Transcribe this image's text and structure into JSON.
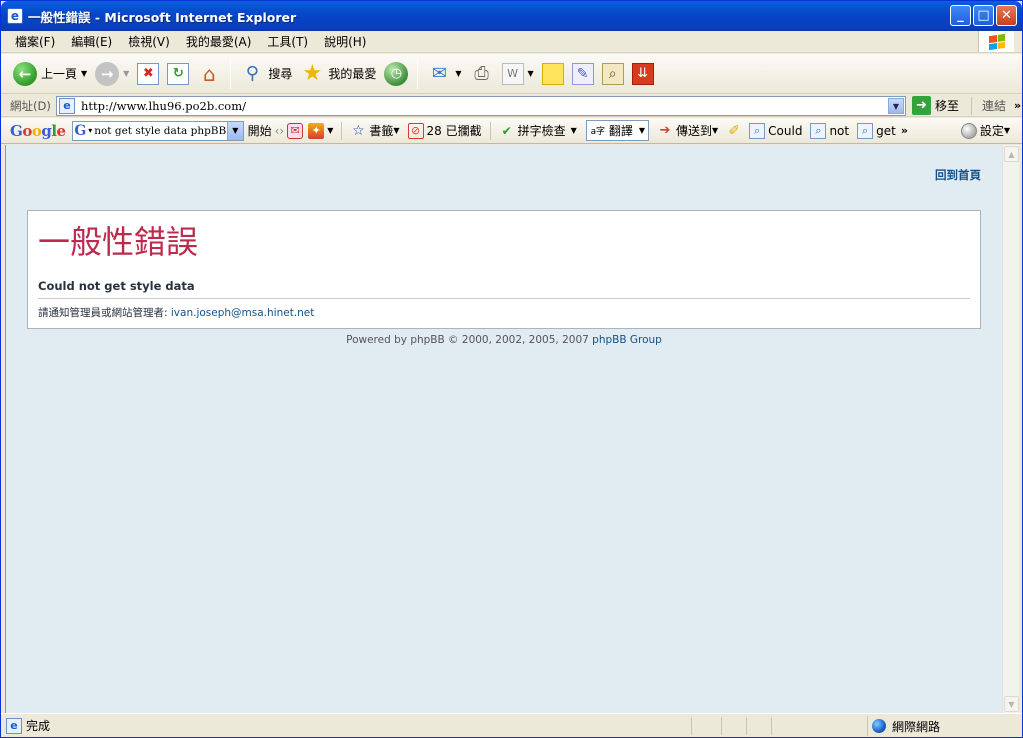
{
  "window": {
    "title": "一般性錯誤 - Microsoft Internet Explorer"
  },
  "menu": [
    "檔案(F)",
    "編輯(E)",
    "檢視(V)",
    "我的最愛(A)",
    "工具(T)",
    "說明(H)"
  ],
  "toolbar": {
    "back_label": "上一頁",
    "search_label": "搜尋",
    "favorites_label": "我的最愛"
  },
  "address": {
    "label": "網址(D)",
    "url": "http://www.lhu96.po2b.com/",
    "go_label": "移至",
    "links_label": "連結"
  },
  "google_toolbar": {
    "logo": "Google",
    "search_text": "not get style data  phpBB",
    "search_button": "開始",
    "bookmarks_label": "書籤",
    "blocked_label": "28 已攔截",
    "spellcheck_label": "拼字檢查",
    "translate_label": "翻譯",
    "sendto_label": "傳送到",
    "word1": "Could",
    "word2": "not",
    "word3": "get",
    "settings_label": "設定"
  },
  "page": {
    "home_link": "回到首頁",
    "error_title": "一般性錯誤",
    "error_message": "Could not get style data",
    "notice_prefix": "請通知管理員或網站管理者:",
    "notice_email": "ivan.joseph@msa.hinet.net",
    "footer_prefix": "Powered by phpBB © 2000, 2002, 2005, 2007",
    "footer_group": "phpBB Group"
  },
  "status": {
    "text": "完成",
    "zone": "網際網路"
  },
  "colors": {
    "content_bg": "#e1ebf2",
    "error_title": "#bc2a4d",
    "link": "#105289"
  }
}
